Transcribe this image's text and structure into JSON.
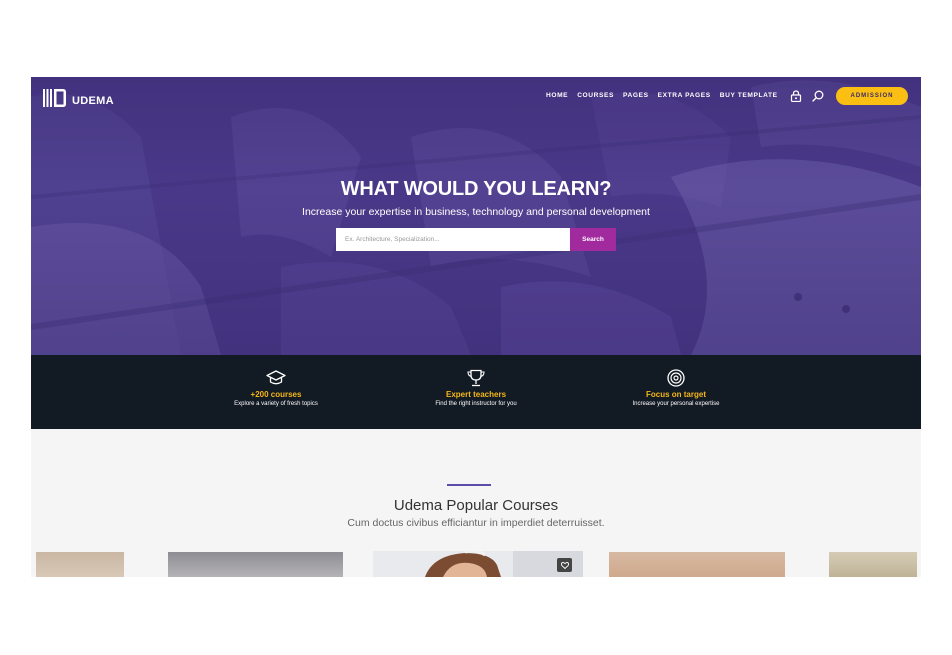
{
  "header": {
    "logo_text": "UDEMA",
    "nav": [
      "HOME",
      "COURSES",
      "PAGES",
      "EXTRA PAGES",
      "BUY TEMPLATE"
    ],
    "admission_label": "ADMISSION"
  },
  "hero": {
    "title": "WHAT WOULD YOU LEARN?",
    "subtitle": "Increase your expertise in business, technology and personal development",
    "search_placeholder": "Ex. Architecture, Specialization...",
    "search_button": "Search"
  },
  "features": [
    {
      "icon": "graduation-cap-icon",
      "title": "+200 courses",
      "desc": "Explore a variety of fresh topics"
    },
    {
      "icon": "trophy-icon",
      "title": "Expert teachers",
      "desc": "Find the right instructor for you"
    },
    {
      "icon": "target-icon",
      "title": "Focus on target",
      "desc": "Increase your personal expertise"
    }
  ],
  "courses": {
    "title": "Udema Popular Courses",
    "subtitle": "Cum doctus civibus efficiantur in imperdiet deterruisset."
  },
  "colors": {
    "hero_purple": "#4a3888",
    "admission_yellow": "#fbbf14",
    "search_magenta": "#a02a9e",
    "features_bg": "#121a24",
    "feature_title": "#f6b818",
    "accent_line": "#5b4caa"
  }
}
